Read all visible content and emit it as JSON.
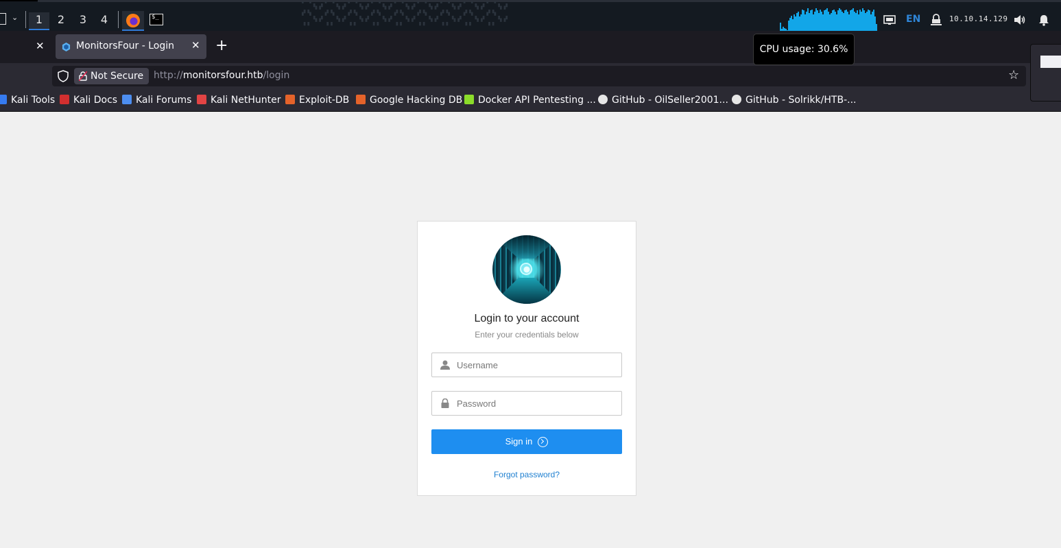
{
  "panel": {
    "workspaces": [
      "1",
      "2",
      "3",
      "4"
    ],
    "active_workspace": "1",
    "language": "EN",
    "ip_address": "10.10.14.129",
    "cpu_history": [
      0.35,
      0.1,
      0.2,
      0.15,
      0.1,
      0.05,
      0.45,
      0.55,
      0.65,
      0.5,
      0.7,
      0.6,
      0.75,
      0.8,
      0.6,
      0.7,
      0.9,
      0.85,
      0.7,
      0.8,
      0.95,
      0.75,
      0.85,
      0.9,
      0.7,
      0.8,
      0.95,
      0.85,
      0.75,
      0.9,
      0.8,
      0.7,
      0.85,
      0.9,
      0.95,
      0.8,
      0.7,
      0.75,
      0.85,
      0.9,
      0.8,
      0.7,
      0.85,
      0.95,
      0.9,
      0.8,
      0.75,
      0.85,
      0.9,
      0.8,
      0.7,
      0.85,
      0.9,
      0.95,
      0.8,
      0.75,
      0.85,
      0.7,
      0.9,
      0.8,
      0.95,
      0.85,
      0.75,
      0.8,
      0.9,
      0.85,
      0.7,
      0.8,
      0.9,
      0.6,
      0.3
    ],
    "accent_color": "#12a6e8",
    "icons": [
      "window-icon",
      "chevron-down-icon",
      "firefox-icon",
      "terminal-icon",
      "network-icon",
      "vpn-icon",
      "volume-icon",
      "bell-icon"
    ]
  },
  "tooltip": {
    "text": "CPU usage: 30.6%"
  },
  "browser": {
    "tab_title": "MonitorsFour - Login",
    "security_label": "Not Secure",
    "url_scheme": "http://",
    "url_host": "monitorsfour.htb",
    "url_path": "/login",
    "bookmarks": [
      {
        "label": "Kali Tools",
        "icon_color": "#367bf0"
      },
      {
        "label": "Kali Docs",
        "icon_color": "#d22f2f"
      },
      {
        "label": "Kali Forums",
        "icon_color": "#4d8ef0"
      },
      {
        "label": "Kali NetHunter",
        "icon_color": "#e24444"
      },
      {
        "label": "Exploit-DB",
        "icon_color": "#e5632a"
      },
      {
        "label": "Google Hacking DB",
        "icon_color": "#e5632a"
      },
      {
        "label": "Docker API Pentesting ...",
        "icon_color": "#8bdc2a"
      },
      {
        "label": "GitHub - OilSeller2001...",
        "icon_color": "#e6e6e6"
      },
      {
        "label": "GitHub - Solrikk/HTB-...",
        "icon_color": "#e6e6e6"
      }
    ]
  },
  "login": {
    "title": "Login to your account",
    "subtitle": "Enter your credentials below",
    "username_placeholder": "Username",
    "password_placeholder": "Password",
    "signin_label": "Sign in",
    "forgot_label": "Forgot password?",
    "button_color": "#1e8ef0"
  }
}
